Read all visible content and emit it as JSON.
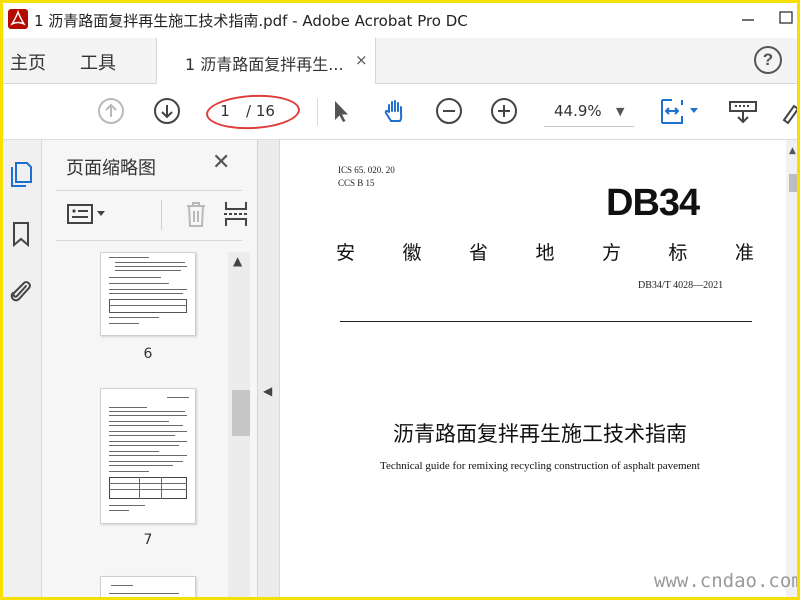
{
  "window": {
    "title": "1 沥青路面复拌再生施工技术指南.pdf - Adobe Acrobat Pro DC"
  },
  "tabs": {
    "home": "主页",
    "tools": "工具",
    "document": "1 沥青路面复拌再生...",
    "document_close": "×"
  },
  "toolbar": {
    "current_page": "1",
    "total_pages": "/ 16",
    "zoom": "44.9%",
    "zoom_caret": "▼",
    "icons": [
      "page-up-icon",
      "page-down-icon",
      "select-arrow-icon",
      "hand-icon",
      "zoom-out-icon",
      "zoom-in-icon",
      "fit-page-icon",
      "print-icon",
      "sign-icon"
    ]
  },
  "help": "?",
  "sidebar_rail": {
    "icons": [
      "page-thumbnails-icon",
      "bookmark-icon",
      "attachment-icon"
    ]
  },
  "thumbnails_panel": {
    "title": "页面缩略图",
    "close": "✕",
    "tools": [
      "thumbnail-options-icon",
      "delete-page-icon",
      "insert-page-icon",
      "rotate-page-icon"
    ],
    "thumbs": [
      {
        "label": "6"
      },
      {
        "label": "7"
      }
    ]
  },
  "document": {
    "ics": "ICS  65. 020. 20",
    "ccs": "CCS  B  15",
    "standard_code": "DB34",
    "province_chars": [
      "安",
      "徽",
      "省",
      "地",
      "方",
      "标",
      "准"
    ],
    "number": "DB34/T  4028—2021",
    "title_cn": "沥青路面复拌再生施工技术指南",
    "title_en": "Technical guide for remixing recycling construction of asphalt pavement"
  },
  "watermark": "www.cndao.com",
  "colors": {
    "frame": "#f5e000",
    "accent_blue": "#1f6fd0",
    "annotation_red": "#e03c3c"
  }
}
